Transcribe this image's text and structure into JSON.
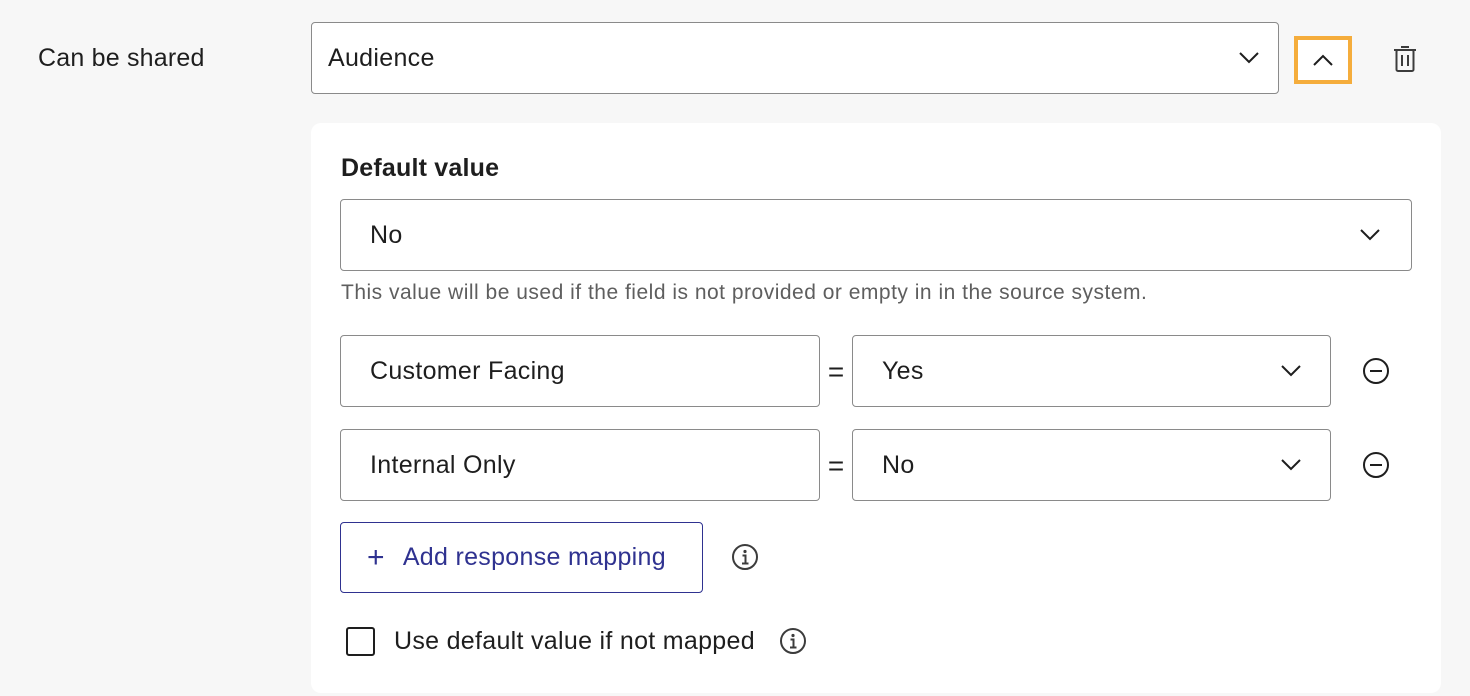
{
  "field": {
    "label": "Can be shared",
    "source_select": {
      "value": "Audience",
      "icon": "chevron-down-icon"
    },
    "collapse_icon": "chevron-up-icon",
    "delete_icon": "trash-icon"
  },
  "panel": {
    "default_heading": "Default value",
    "default_select": {
      "value": "No",
      "icon": "chevron-down-icon"
    },
    "helper_text": "This value will be used if the field is not provided or empty in in the source system.",
    "mappings": [
      {
        "source": "Customer Facing",
        "operator": "=",
        "value": "Yes"
      },
      {
        "source": "Internal Only",
        "operator": "=",
        "value": "No"
      }
    ],
    "add_mapping": {
      "icon": "+",
      "label": "Add response mapping"
    },
    "use_default_checkbox": {
      "label": "Use default value if not mapped",
      "checked": false
    }
  },
  "colors": {
    "focus_ring": "#f5ad3c",
    "link_primary": "#2f3290",
    "border": "#8a8a8a",
    "background": "#f7f7f7",
    "panel_bg": "#ffffff"
  }
}
